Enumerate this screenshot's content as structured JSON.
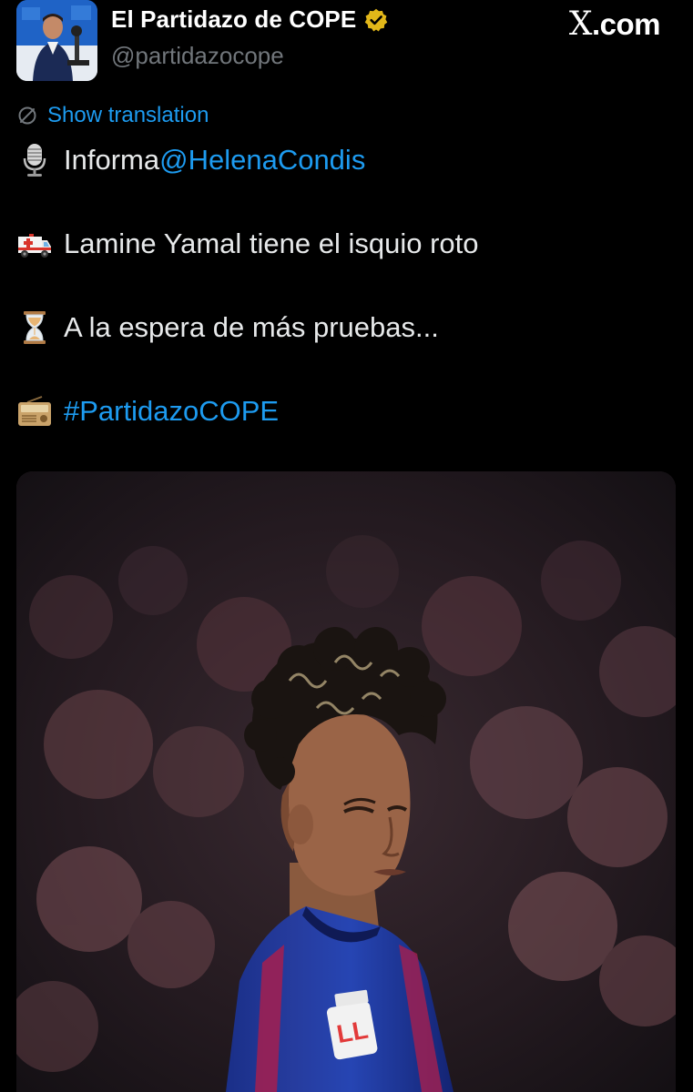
{
  "header": {
    "display_name": "El Partidazo de COPE",
    "handle": "@partidazocope",
    "site_label": "X.com",
    "site_mark": "X",
    "site_suffix": ".com"
  },
  "translation": {
    "label": "Show translation"
  },
  "tweet": {
    "lines": [
      {
        "emoji": "studio-microphone-icon",
        "text": "Informa ",
        "link": "@HelenaCondis"
      },
      {
        "emoji": "ambulance-icon",
        "text": "Lamine Yamal tiene el isquio roto"
      },
      {
        "emoji": "hourglass-icon",
        "text": "A la espera de más pruebas..."
      },
      {
        "emoji": "radio-icon",
        "link": "#PartidazoCOPE"
      }
    ]
  },
  "media": {
    "shirt_badge_text": "LL"
  },
  "colors": {
    "background": "#000000",
    "primary_text": "#e7e9ea",
    "secondary_text": "#71767b",
    "link": "#1d9bf0",
    "verified_badge": "#e2b719"
  }
}
